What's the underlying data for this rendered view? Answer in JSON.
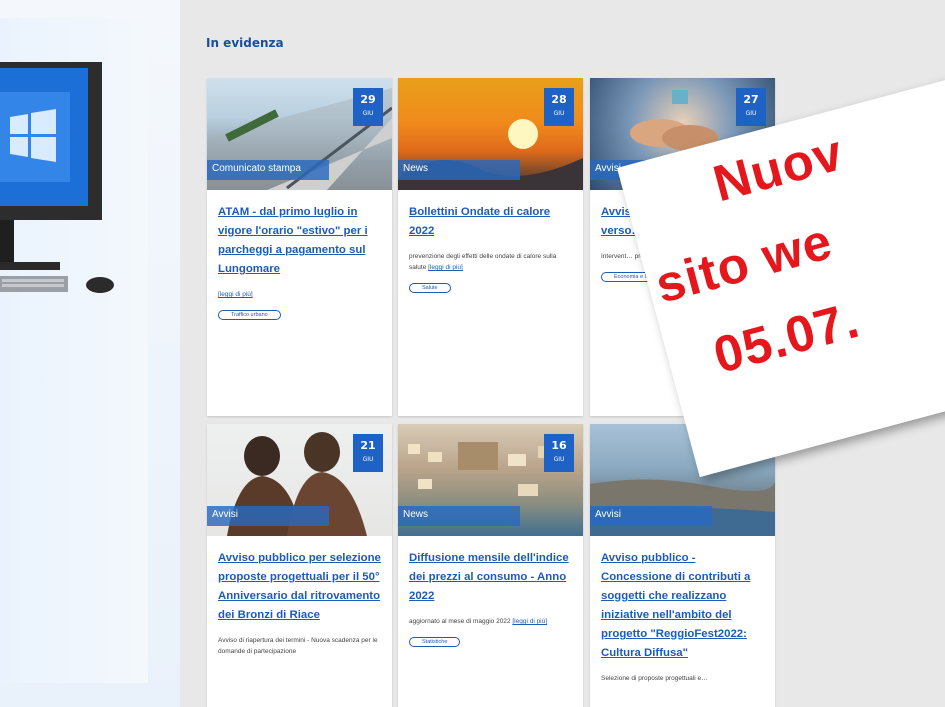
{
  "section": {
    "title": "In evidenza"
  },
  "cards": [
    {
      "day": "29",
      "month": "GIU",
      "category": "Comunicato stampa",
      "title": "ATAM - dal primo luglio in vigore l'orario \"estivo\" per i parcheggi a pagamento sul Lungomare",
      "desc": "",
      "more": "[leggi di più]",
      "tag": "Traffico urbano"
    },
    {
      "day": "28",
      "month": "GIU",
      "category": "News",
      "title": "Bollettini Ondate di calore 2022",
      "desc": "prevenzione degli effetti delle ondate di calore sulla salute ",
      "more": "[leggi di più]",
      "tag": "Salute"
    },
    {
      "day": "27",
      "month": "GIU",
      "category": "Avvisi",
      "title": "Avviso Co… Imp… dell'… verso…",
      "desc": "Intervent… presentaz… 30-09-202…",
      "more": "",
      "tag": "Economia e la…"
    },
    {
      "day": "21",
      "month": "GIU",
      "category": "Avvisi",
      "title": "Avviso pubblico per selezione proposte progettuali per il 50° Anniversario dal ritrovamento dei Bronzi di Riace",
      "desc": "Avviso di riapertura dei termini - Nuova scadenza per le domande di partecipazione",
      "more": "",
      "tag": ""
    },
    {
      "day": "16",
      "month": "GIU",
      "category": "News",
      "title": "Diffusione mensile dell'indice dei prezzi al consumo - Anno 2022",
      "desc": "aggiornato al mese di maggio 2022 ",
      "more": "[leggi di più]",
      "tag": "Statistiche"
    },
    {
      "day": "",
      "month": "",
      "category": "Avvisi",
      "title": "Avviso pubblico - Concessione di contributi a soggetti che realizzano iniziative nell'ambito del progetto \"ReggioFest2022: Cultura Diffusa\"",
      "desc": "Selezione di proposte progettuali e…",
      "more": "",
      "tag": ""
    }
  ],
  "overlay": {
    "line1": "Nuov",
    "line2": "sito we",
    "line3": "05.07."
  },
  "colors": {
    "accent": "#1d62c4",
    "link": "#1d5bb8",
    "overlay_text": "#e4171c"
  }
}
